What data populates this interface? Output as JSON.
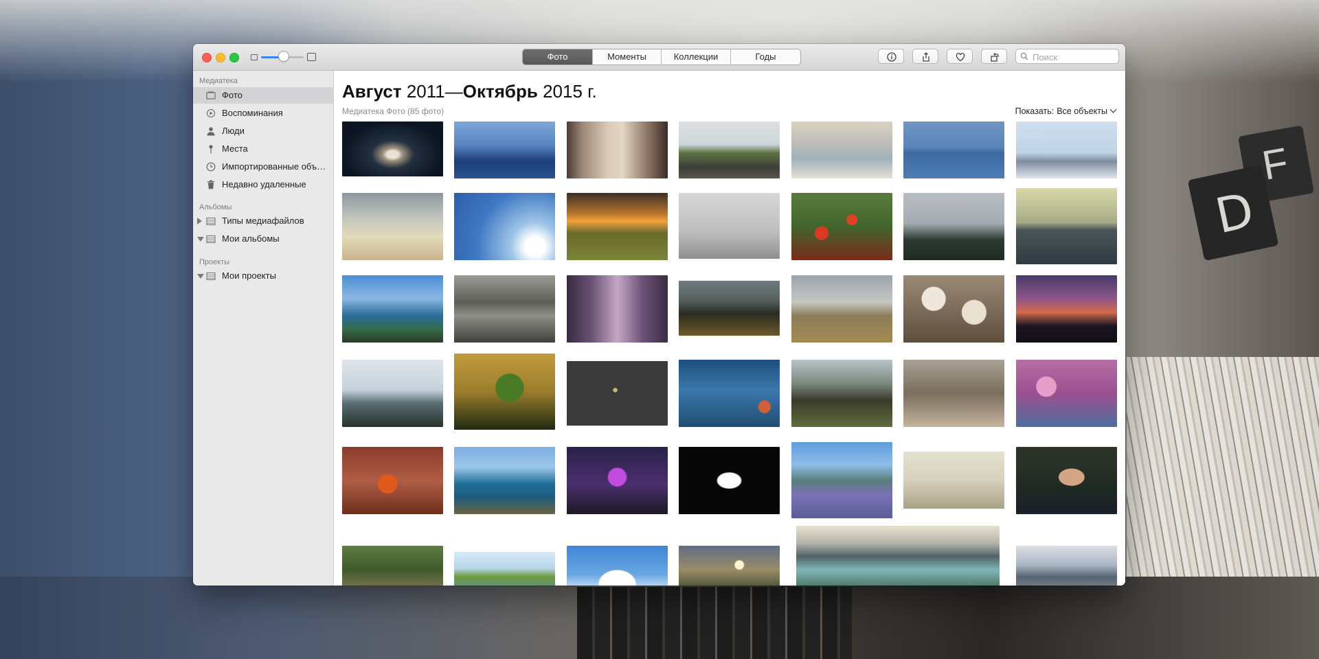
{
  "toolbar": {
    "tabs": [
      {
        "label": "Фото",
        "active": true
      },
      {
        "label": "Моменты",
        "active": false
      },
      {
        "label": "Коллекции",
        "active": false
      },
      {
        "label": "Годы",
        "active": false
      }
    ],
    "buttons": [
      "info-icon",
      "share-icon",
      "heart-icon",
      "rotate-icon"
    ],
    "search_placeholder": "Поиск",
    "zoom_level": 0.5
  },
  "sidebar": {
    "sections": [
      {
        "title": "Медиатека",
        "items": [
          {
            "label": "Фото",
            "icon": "photos-icon",
            "selected": true
          },
          {
            "label": "Воспоминания",
            "icon": "memories-icon",
            "selected": false
          },
          {
            "label": "Люди",
            "icon": "person-icon",
            "selected": false
          },
          {
            "label": "Места",
            "icon": "pin-icon",
            "selected": false
          },
          {
            "label": "Импортированные объекты",
            "icon": "clock-icon",
            "selected": false
          },
          {
            "label": "Недавно удаленные",
            "icon": "trash-icon",
            "selected": false
          }
        ]
      },
      {
        "title": "Альбомы",
        "items": [
          {
            "label": "Типы медиафайлов",
            "icon": "folder-icon",
            "disclosure": "collapsed"
          },
          {
            "label": "Мои альбомы",
            "icon": "folder-icon",
            "disclosure": "expanded"
          }
        ]
      },
      {
        "title": "Проекты",
        "items": [
          {
            "label": "Мои проекты",
            "icon": "folder-icon",
            "disclosure": "expanded"
          }
        ]
      }
    ]
  },
  "main": {
    "heading": {
      "month1": "Август",
      "year1": "2011",
      "dash": "—",
      "month2": "Октябрь",
      "year2": "2015 г."
    },
    "subheading": "Медиатека Фото (85 фото)",
    "filter_label": "Показать:",
    "filter_value": "Все объекты"
  },
  "colors": {
    "accent": "#3b82f6",
    "segment_active": "#5f5f5f",
    "sidebar_bg": "#e9e9ea",
    "sidebar_selected": "#d3d3d5"
  }
}
